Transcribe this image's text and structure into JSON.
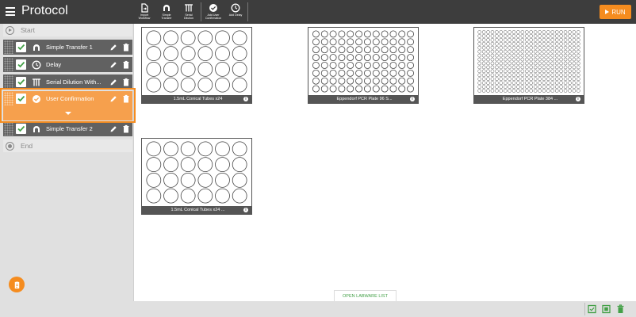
{
  "header": {
    "title": "Protocol",
    "run_label": "RUN",
    "toolbar": [
      {
        "icon": "import-workflow-icon",
        "label": "Import\nWorkflow"
      },
      {
        "icon": "simple-transfer-icon",
        "label": "Simple\nTransfer"
      },
      {
        "icon": "serial-dilution-icon",
        "label": "Serial\nDilution"
      },
      {
        "icon": "user-confirmation-icon",
        "label": "Add User\nConfirmation"
      },
      {
        "icon": "delay-icon",
        "label": "Add Delay"
      }
    ]
  },
  "sidebar": {
    "start_label": "Start",
    "end_label": "End",
    "steps": [
      {
        "label": "Simple Transfer 1",
        "icon": "pipette-icon",
        "checked": true,
        "selected": false
      },
      {
        "label": "Delay",
        "icon": "clock-icon",
        "checked": true,
        "selected": false
      },
      {
        "label": "Serial Dilution With...",
        "icon": "serial-dilution-icon",
        "checked": true,
        "selected": false
      },
      {
        "label": "User Confirmation",
        "icon": "check-circle-icon",
        "checked": true,
        "selected": true
      },
      {
        "label": "Simple Transfer 2",
        "icon": "pipette-icon",
        "checked": true,
        "selected": false
      }
    ]
  },
  "labware": [
    {
      "label": "1.5mL Conical Tubes x24",
      "rows": 4,
      "cols": 6
    },
    {
      "label": "Eppendorf PCR Plate 96 S...",
      "rows": 8,
      "cols": 12
    },
    {
      "label": "Eppendorf PCR Plate 384 ...",
      "rows": 16,
      "cols": 24
    },
    {
      "label": "1.5mL Conical Tubes x24 ...",
      "rows": 4,
      "cols": 6
    }
  ],
  "labware_info_glyph": "i",
  "open_labware_label": "OPEN LABWARE LIST",
  "colors": {
    "accent": "#f58c1f",
    "header_bg": "#3d3d3d",
    "step_bg": "#616161",
    "check_green": "#43a047"
  }
}
